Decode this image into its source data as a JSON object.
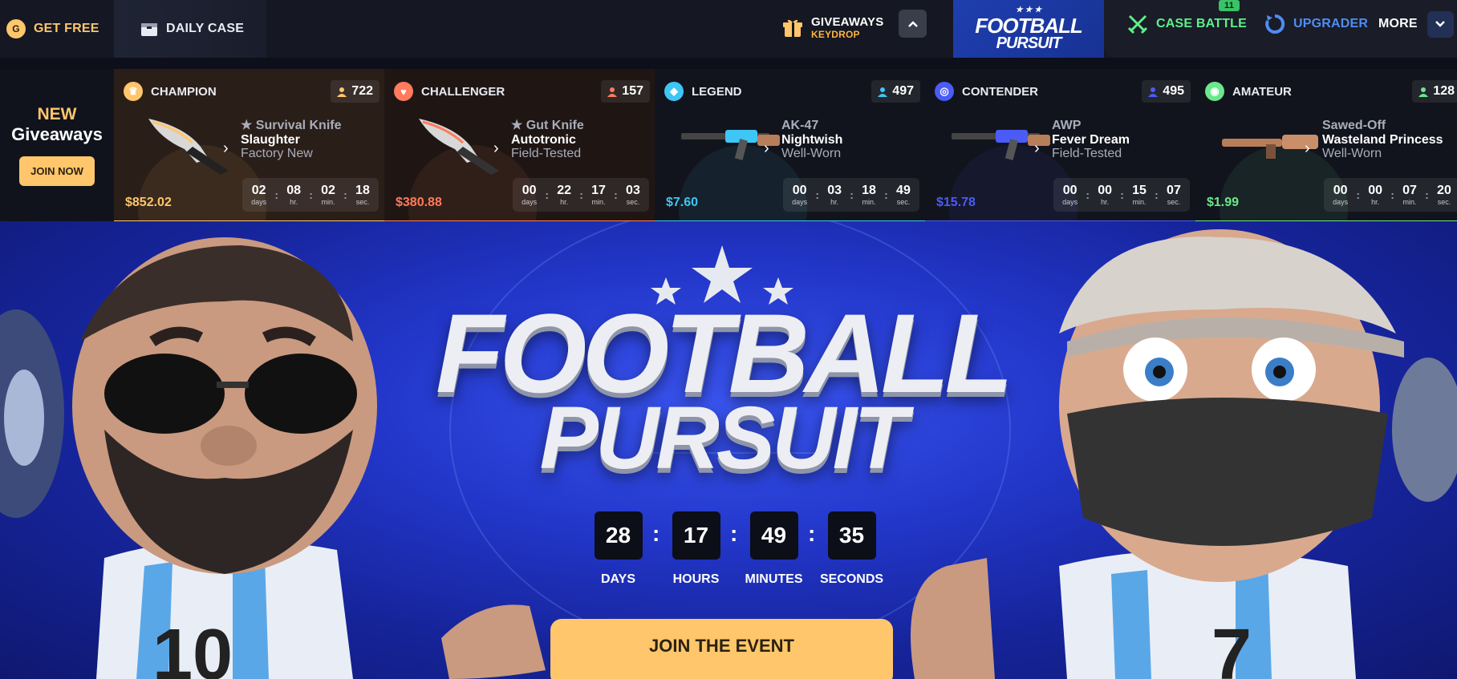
{
  "topbar": {
    "get_free": "GET FREE",
    "daily_case": "DAILY CASE",
    "giveaways": "GIVEAWAYS",
    "keydrop": "KEYDROP",
    "logo_line1": "FOOTBALL",
    "logo_line2": "PURSUIT",
    "case_battle": "CASE BATTLE",
    "case_battle_badge": "11",
    "upgrader": "UPGRADER",
    "more": "MORE"
  },
  "new_giveaways": {
    "line1": "NEW",
    "line2": "Giveaways",
    "join": "JOIN NOW"
  },
  "cards": [
    {
      "tier": "CHAMPION",
      "count": "722",
      "line1": "★ Survival Knife",
      "line2": "Slaughter",
      "line3": "Factory New",
      "price": "$852.02",
      "days": "02",
      "hr": "08",
      "min": "02",
      "sec": "18",
      "accent": "#ffc66b",
      "bg": "#2a1e18"
    },
    {
      "tier": "CHALLENGER",
      "count": "157",
      "line1": "★ Gut Knife",
      "line2": "Autotronic",
      "line3": "Field-Tested",
      "price": "$380.88",
      "days": "00",
      "hr": "22",
      "min": "17",
      "sec": "03",
      "accent": "#ff7b5c",
      "bg": "#1f1614"
    },
    {
      "tier": "LEGEND",
      "count": "497",
      "line1": "AK-47",
      "line2": "Nightwish",
      "line3": "Well-Worn",
      "price": "$7.60",
      "days": "00",
      "hr": "03",
      "min": "18",
      "sec": "49",
      "accent": "#3ec6f5",
      "bg": "#12141d"
    },
    {
      "tier": "CONTENDER",
      "count": "495",
      "line1": "AWP",
      "line2": "Fever Dream",
      "line3": "Field-Tested",
      "price": "$15.78",
      "days": "00",
      "hr": "00",
      "min": "15",
      "sec": "07",
      "accent": "#4a5cf5",
      "bg": "#12141d"
    },
    {
      "tier": "AMATEUR",
      "count": "128",
      "line1": "Sawed-Off",
      "line2": "Wasteland Princess",
      "line3": "Well-Worn",
      "price": "$1.99",
      "days": "00",
      "hr": "00",
      "min": "07",
      "sec": "20",
      "accent": "#6be88c",
      "bg": "#12141d"
    }
  ],
  "timer_labels": {
    "days": "days",
    "hr": "hr.",
    "min": "min.",
    "sec": "sec."
  },
  "hero": {
    "title1": "FOOTBALL",
    "title2": "PURSUIT",
    "countdown": [
      {
        "value": "28",
        "label": "DAYS"
      },
      {
        "value": "17",
        "label": "HOURS"
      },
      {
        "value": "49",
        "label": "MINUTES"
      },
      {
        "value": "35",
        "label": "SECONDS"
      }
    ],
    "join_event": "JOIN THE EVENT"
  }
}
